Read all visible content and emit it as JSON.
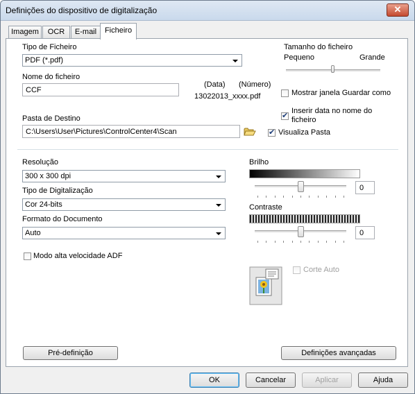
{
  "window": {
    "title": "Definições do dispositivo de digitalização",
    "close_glyph": "✕"
  },
  "tabs": [
    {
      "label": "Imagem"
    },
    {
      "label": "OCR"
    },
    {
      "label": "E-mail"
    },
    {
      "label": "Ficheiro",
      "active": true
    }
  ],
  "file": {
    "type_label": "Tipo de Ficheiro",
    "type_value": "PDF (*.pdf)",
    "name_label": "Nome do ficheiro",
    "name_value": "CCF",
    "date_label": "(Data)",
    "number_label": "(Número)",
    "filename_example": "13022013_xxxx.pdf",
    "size_label": "Tamanho do ficheiro",
    "size_small": "Pequeno",
    "size_large": "Grande",
    "size_level_percent": 50,
    "show_save_as_label": "Mostrar janela Guardar como",
    "show_save_as_checked": false,
    "insert_date_label": "Inserir data no nome do ficheiro",
    "insert_date_checked": true,
    "dest_label": "Pasta de Destino",
    "dest_value": "C:\\Users\\User\\Pictures\\ControlCenter4\\Scan",
    "show_folder_label": "Visualiza Pasta",
    "show_folder_checked": true
  },
  "scan": {
    "resolution_label": "Resolução",
    "resolution_value": "300 x 300 dpi",
    "scantype_label": "Tipo de Digitalização",
    "scantype_value": "Cor 24-bits",
    "docsize_label": "Formato do Documento",
    "docsize_value": "Auto",
    "adf_label": "Modo alta velocidade ADF",
    "adf_checked": false,
    "brightness_label": "Brilho",
    "brightness_value": "0",
    "contrast_label": "Contraste",
    "contrast_value": "0",
    "autocrop_label": "Corte Auto",
    "autocrop_checked": false
  },
  "panel_buttons": {
    "preset": "Pré-definição",
    "advanced": "Definições avançadas"
  },
  "dialog_buttons": {
    "ok": "OK",
    "cancel": "Cancelar",
    "apply": "Aplicar",
    "help": "Ajuda"
  }
}
